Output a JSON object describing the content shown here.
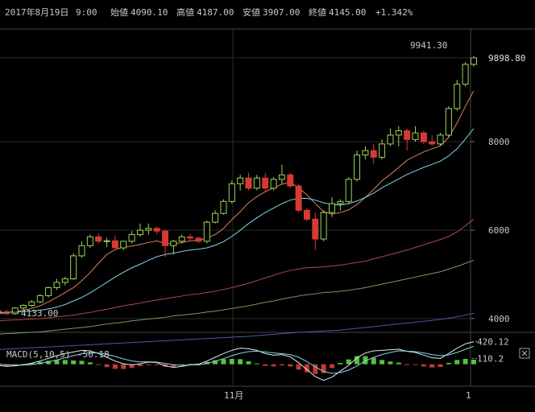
{
  "info_bar": {
    "date": "2017年8月19日",
    "time": "9:00",
    "open_label": "始値",
    "open_value": "4090.10",
    "high_label": "高値",
    "high_value": "4187.00",
    "low_label": "安値",
    "low_value": "3907.00",
    "close_label": "終値",
    "close_value": "4145.00",
    "change": "+1.342%"
  },
  "chart_data": {
    "type": "candlestick",
    "price_axis": {
      "ticks": [
        "9898.80",
        "8000",
        "6000",
        "4000"
      ],
      "tick_values": [
        9898.8,
        8000,
        6000,
        4000
      ],
      "range": [
        3690,
        10550
      ]
    },
    "annotations": {
      "current_price": "9898.80",
      "max_label": "9941.30",
      "min_label": "4133.00"
    },
    "x_axis_labels": [
      "11月",
      "1"
    ],
    "candles": [
      [
        4180,
        4250,
        4120,
        4150
      ],
      [
        4150,
        4200,
        4080,
        4110
      ],
      [
        4110,
        4260,
        4090,
        4240
      ],
      [
        4240,
        4320,
        4200,
        4300
      ],
      [
        4300,
        4420,
        4260,
        4380
      ],
      [
        4380,
        4560,
        4350,
        4520
      ],
      [
        4520,
        4720,
        4480,
        4700
      ],
      [
        4700,
        4900,
        4650,
        4820
      ],
      [
        4820,
        4950,
        4750,
        4900
      ],
      [
        4900,
        5480,
        4880,
        5420
      ],
      [
        5420,
        5750,
        5380,
        5650
      ],
      [
        5650,
        5900,
        5600,
        5850
      ],
      [
        5850,
        5920,
        5700,
        5750
      ],
      [
        5750,
        5830,
        5620,
        5760
      ],
      [
        5760,
        5880,
        5650,
        5600
      ],
      [
        5600,
        5760,
        5550,
        5750
      ],
      [
        5750,
        5980,
        5700,
        5900
      ],
      [
        5900,
        6150,
        5850,
        6000
      ],
      [
        6000,
        6150,
        5900,
        6040
      ],
      [
        6040,
        6080,
        5900,
        5980
      ],
      [
        5980,
        6020,
        5400,
        5650
      ],
      [
        5650,
        5780,
        5450,
        5750
      ],
      [
        5750,
        5900,
        5700,
        5850
      ],
      [
        5850,
        5920,
        5760,
        5820
      ],
      [
        5820,
        5860,
        5700,
        5750
      ],
      [
        5750,
        6220,
        5700,
        6180
      ],
      [
        6180,
        6450,
        6150,
        6380
      ],
      [
        6380,
        6700,
        6350,
        6650
      ],
      [
        6650,
        7120,
        6600,
        7050
      ],
      [
        7050,
        7250,
        6900,
        7180
      ],
      [
        7180,
        7300,
        6900,
        6950
      ],
      [
        6950,
        7250,
        6900,
        7180
      ],
      [
        7180,
        7300,
        6850,
        6950
      ],
      [
        6950,
        7200,
        6900,
        7150
      ],
      [
        7150,
        7480,
        7050,
        7250
      ],
      [
        7250,
        7300,
        6950,
        7000
      ],
      [
        7000,
        7050,
        6400,
        6450
      ],
      [
        6450,
        6500,
        6200,
        6250
      ],
      [
        6250,
        6400,
        5550,
        5800
      ],
      [
        5800,
        6450,
        5750,
        6400
      ],
      [
        6400,
        6750,
        6300,
        6600
      ],
      [
        6600,
        6700,
        6450,
        6650
      ],
      [
        6650,
        7200,
        6600,
        7150
      ],
      [
        7150,
        7800,
        7100,
        7700
      ],
      [
        7700,
        7900,
        7600,
        7800
      ],
      [
        7800,
        7950,
        7500,
        7650
      ],
      [
        7650,
        8050,
        7600,
        7950
      ],
      [
        7950,
        8300,
        7900,
        8150
      ],
      [
        8150,
        8350,
        7900,
        8250
      ],
      [
        8250,
        8300,
        7800,
        8050
      ],
      [
        8050,
        8350,
        8000,
        8200
      ],
      [
        8200,
        8250,
        7950,
        8000
      ],
      [
        8000,
        8150,
        7900,
        7950
      ],
      [
        7950,
        8200,
        7900,
        8150
      ],
      [
        8150,
        8800,
        8100,
        8750
      ],
      [
        8750,
        9400,
        8700,
        9300
      ],
      [
        9300,
        9800,
        9250,
        9750
      ],
      [
        9750,
        9941.3,
        9700,
        9898.8
      ]
    ],
    "moving_averages": [
      {
        "color": "#d9855a",
        "values": [
          4110,
          4140,
          4160,
          4190,
          4230,
          4290,
          4380,
          4480,
          4590,
          4700,
          4860,
          5040,
          5250,
          5450,
          5560,
          5620,
          5640,
          5680,
          5720,
          5760,
          5700,
          5690,
          5720,
          5760,
          5770,
          5820,
          5900,
          6040,
          6240,
          6420,
          6620,
          6760,
          6870,
          6960,
          7040,
          7080,
          6960,
          6800,
          6600,
          6420,
          6360,
          6400,
          6460,
          6580,
          6740,
          6920,
          7120,
          7260,
          7420,
          7580,
          7680,
          7770,
          7840,
          7910,
          8100,
          8420,
          8800,
          9150
        ]
      },
      {
        "color": "#7fd6e8",
        "values": [
          4130,
          4140,
          4150,
          4160,
          4170,
          4190,
          4220,
          4260,
          4320,
          4400,
          4480,
          4580,
          4700,
          4820,
          4940,
          5050,
          5150,
          5230,
          5320,
          5400,
          5450,
          5480,
          5520,
          5550,
          5570,
          5600,
          5660,
          5740,
          5860,
          6000,
          6150,
          6280,
          6400,
          6500,
          6600,
          6680,
          6720,
          6720,
          6680,
          6620,
          6580,
          6570,
          6600,
          6660,
          6740,
          6840,
          6960,
          7060,
          7160,
          7260,
          7340,
          7420,
          7490,
          7560,
          7680,
          7840,
          8060,
          8300
        ]
      },
      {
        "color": "#b04848",
        "values": [
          3950,
          3960,
          3970,
          3980,
          3990,
          4000,
          4020,
          4040,
          4060,
          4080,
          4110,
          4140,
          4180,
          4210,
          4250,
          4290,
          4320,
          4350,
          4390,
          4420,
          4450,
          4480,
          4510,
          4540,
          4560,
          4590,
          4620,
          4660,
          4700,
          4750,
          4800,
          4860,
          4920,
          4980,
          5040,
          5090,
          5120,
          5150,
          5160,
          5170,
          5190,
          5210,
          5240,
          5270,
          5300,
          5350,
          5400,
          5450,
          5500,
          5550,
          5610,
          5670,
          5730,
          5790,
          5860,
          5960,
          6100,
          6250
        ]
      },
      {
        "color": "#6f9e5e",
        "values": [
          3650,
          3660,
          3670,
          3680,
          3690,
          3700,
          3720,
          3740,
          3760,
          3780,
          3800,
          3820,
          3850,
          3880,
          3900,
          3920,
          3950,
          3970,
          3990,
          4010,
          4030,
          4060,
          4080,
          4100,
          4120,
          4150,
          4170,
          4200,
          4230,
          4260,
          4290,
          4330,
          4370,
          4400,
          4440,
          4480,
          4510,
          4540,
          4560,
          4590,
          4600,
          4620,
          4640,
          4670,
          4700,
          4740,
          4780,
          4820,
          4860,
          4900,
          4940,
          4980,
          5020,
          5060,
          5120,
          5180,
          5250,
          5320
        ]
      },
      {
        "color": "#4b5aa8",
        "values": [
          3300,
          3310,
          3320,
          3330,
          3340,
          3350,
          3360,
          3370,
          3380,
          3390,
          3400,
          3410,
          3420,
          3430,
          3440,
          3450,
          3460,
          3470,
          3480,
          3490,
          3500,
          3510,
          3520,
          3530,
          3540,
          3550,
          3560,
          3570,
          3580,
          3590,
          3600,
          3615,
          3630,
          3645,
          3660,
          3675,
          3690,
          3700,
          3710,
          3720,
          3730,
          3740,
          3760,
          3780,
          3800,
          3820,
          3840,
          3860,
          3880,
          3900,
          3920,
          3940,
          3960,
          3980,
          4010,
          4040,
          4080,
          4120
        ]
      }
    ],
    "macd": {
      "label": "MACD(5,10,5)",
      "value": "-50.18",
      "axis_labels": [
        "420.12",
        "110.2"
      ],
      "axis_values": [
        420.12,
        110.2
      ],
      "range": [
        -380,
        520
      ],
      "macd_line": [
        -20,
        -40,
        -30,
        -10,
        20,
        60,
        110,
        160,
        200,
        230,
        260,
        250,
        200,
        130,
        60,
        10,
        -10,
        10,
        40,
        30,
        -30,
        -60,
        -40,
        -10,
        0,
        60,
        130,
        200,
        260,
        300,
        290,
        260,
        200,
        170,
        180,
        140,
        30,
        -100,
        -230,
        -300,
        -240,
        -130,
        -20,
        120,
        210,
        250,
        260,
        270,
        280,
        240,
        220,
        170,
        120,
        110,
        200,
        300,
        380,
        420
      ],
      "signal_line": [
        0,
        -10,
        -15,
        -15,
        -5,
        15,
        45,
        80,
        120,
        160,
        195,
        215,
        210,
        185,
        145,
        100,
        60,
        45,
        45,
        40,
        15,
        -10,
        -20,
        -15,
        -10,
        15,
        55,
        105,
        160,
        205,
        235,
        245,
        230,
        210,
        200,
        180,
        130,
        50,
        -50,
        -135,
        -170,
        -155,
        -110,
        -30,
        60,
        130,
        180,
        220,
        250,
        245,
        235,
        210,
        180,
        160,
        175,
        220,
        280,
        335
      ]
    }
  }
}
